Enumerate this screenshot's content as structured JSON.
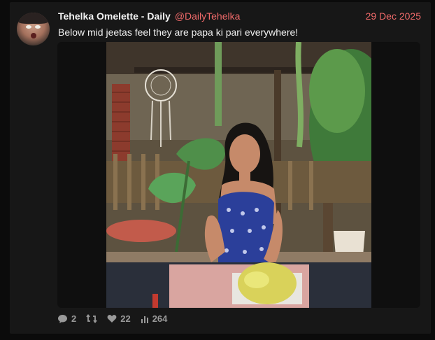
{
  "tweet": {
    "author_name": "Tehelka Omelette - Daily",
    "handle": "@DailyTehelka",
    "date": "29 Dec 2025",
    "text": "Below mid jeetas feel they are papa ki pari everywhere!"
  },
  "media": {
    "icon": "photo-of-woman-in-blue-dress-at-garden-cafe"
  },
  "actions": {
    "replies": "2",
    "likes": "22",
    "views": "264"
  },
  "colors": {
    "accent": "#f06a6a",
    "card_bg": "#171717",
    "page_bg": "#0b0b0b",
    "text": "#f0f0f0",
    "muted": "#9a9a9a"
  }
}
